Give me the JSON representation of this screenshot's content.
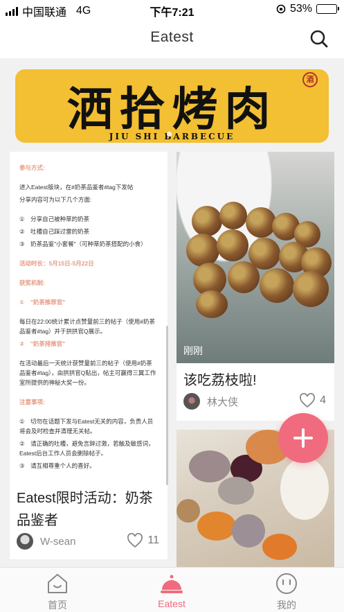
{
  "status_bar": {
    "carrier": "中国联通",
    "network": "4G",
    "time": "下午7:21",
    "battery": "53%",
    "battery_level": 0.53
  },
  "nav": {
    "title": "Eatest",
    "search_icon": "search-icon"
  },
  "banner": {
    "headline": "洒拾烤肉",
    "subline": "JIU SHI BARBECUE",
    "stamp": "酒",
    "dots": 2
  },
  "cards": {
    "left": {
      "poster": {
        "h1": "参与方式:",
        "p1": "进入Eatest版块，在#奶茶品鉴者#tag下发帖",
        "p2": "分享内容可为以下几个方面:",
        "items1": [
          "①　分享自己被种草的奶茶",
          "②　吐槽自己踩过雷的奶茶",
          "③　奶茶品鉴\"小套餐\"（可种草奶茶搭配的小食）"
        ],
        "h2": "活动时长：5月15日-5月22日",
        "h3": "获奖机制:",
        "h4": "①　\"奶茶推荐官\"",
        "p3": "每日在22:00统计累计点赞量前三的帖子（使用#奶茶品鉴者#tag）并于拱拱官Q展示。",
        "h5": "②　\"奶茶排推官\"",
        "p4": "在活动最后一天统计获赞量前三的帖子（使用#奶茶品鉴者#tag），由拱拱官Q贴出，帖主可赢得三翼工作室所提供的神秘大奖一份。",
        "h6": "注意事项:",
        "items2": [
          "①　切勿在话题下发与Eatest无关的内容，负责人员将会及时检查并清理无关帖。",
          "②　请正确的吐槽，避免言辞过激，若触及敏感词，Eatest后台工作人员会删除帖子。",
          "③　请互相尊重个人的喜好。"
        ]
      },
      "title": "Eatest限时活动：奶茶品鉴者",
      "user": "W-sean",
      "likes": "11"
    },
    "right1": {
      "tag": "刚刚",
      "title": "该吃荔枝啦!",
      "user": "林大侠",
      "likes": "4"
    }
  },
  "fab": {
    "icon": "plus-icon"
  },
  "tabbar": {
    "tabs": [
      {
        "label": "首页",
        "icon": "home-icon"
      },
      {
        "label": "Eatest",
        "icon": "cloche-icon"
      },
      {
        "label": "我的",
        "icon": "face-icon"
      }
    ],
    "active_color": "#f06b7d"
  }
}
